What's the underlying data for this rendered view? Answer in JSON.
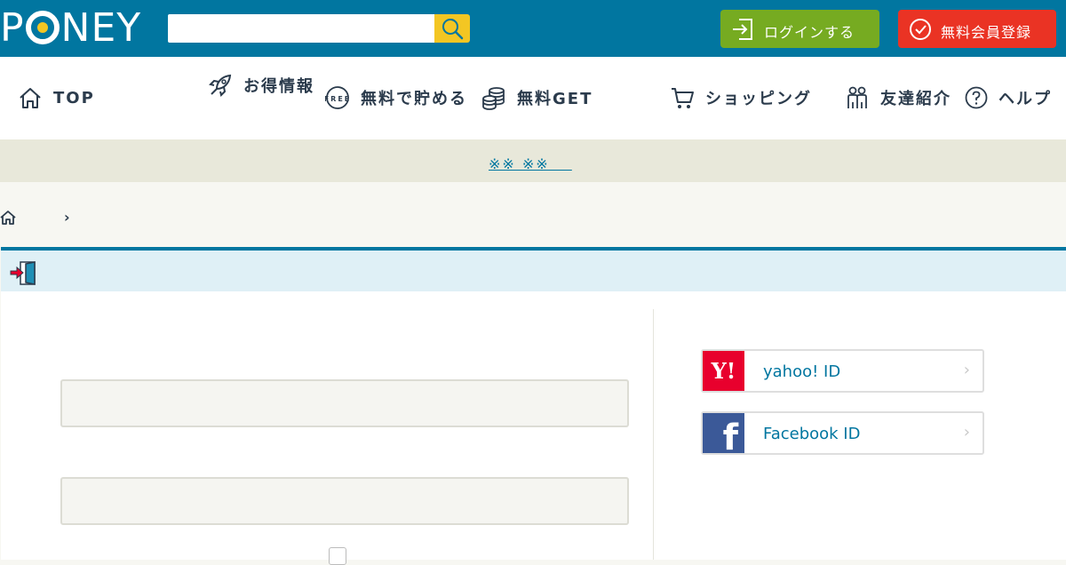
{
  "header": {
    "logo_text": "PONEY",
    "search": {
      "placeholder": ""
    },
    "login_label": "ログインする",
    "register_label": "無料会員登録",
    "colors": {
      "header_bg": "#0176a0",
      "search_button": "#f3c623",
      "login_bg": "#76ab21",
      "register_bg": "#ea3324"
    }
  },
  "nav": {
    "items": [
      {
        "label": "TOP",
        "icon": "home-icon"
      },
      {
        "label": "お得情報",
        "icon": "rocket-icon"
      },
      {
        "label": "無料で貯める",
        "icon": "free-icon"
      },
      {
        "label": "無料GET",
        "icon": "coins-icon"
      },
      {
        "label": "ショッピング",
        "icon": "cart-icon"
      },
      {
        "label": "友達紹介",
        "icon": "people-icon"
      },
      {
        "label": "ヘルプ",
        "icon": "help-icon"
      }
    ]
  },
  "notice": {
    "text": "※※ ※※ 　"
  },
  "breadcrumb": {
    "separator": "›"
  },
  "social": {
    "yahoo": {
      "label": "yahoo! ID",
      "badge": "Y!"
    },
    "facebook": {
      "label": "Facebook ID",
      "badge": "f"
    },
    "chevron": "›"
  }
}
